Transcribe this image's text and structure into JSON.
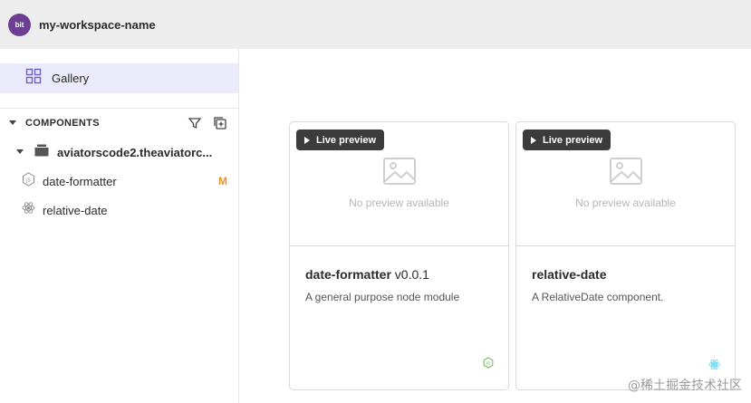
{
  "workspace": {
    "logo_text": "bit",
    "name": "my-workspace-name"
  },
  "sidebar": {
    "gallery_label": "Gallery",
    "components_title": "COMPONENTS",
    "scope_label": "aviatorscode2.theaviatorc...",
    "items": [
      {
        "label": "date-formatter",
        "badge": "M",
        "icon": "nodejs-icon"
      },
      {
        "label": "relative-date",
        "badge": "",
        "icon": "react-icon"
      }
    ]
  },
  "cards": [
    {
      "live_label": "Live preview",
      "no_preview": "No preview available",
      "name": "date-formatter",
      "version": "v0.0.1",
      "description": "A general purpose node module",
      "env_icon": "nodejs-icon"
    },
    {
      "live_label": "Live preview",
      "no_preview": "No preview available",
      "name": "relative-date",
      "version": "",
      "description": "A RelativeDate component.",
      "env_icon": "react-icon"
    }
  ],
  "watermark": "@稀土掘金技术社区",
  "colors": {
    "accent": "#6c3f94",
    "gallery_bg": "#ebeafb",
    "modified": "#e8922b",
    "node": "#6cc24a",
    "react": "#61dafb"
  }
}
